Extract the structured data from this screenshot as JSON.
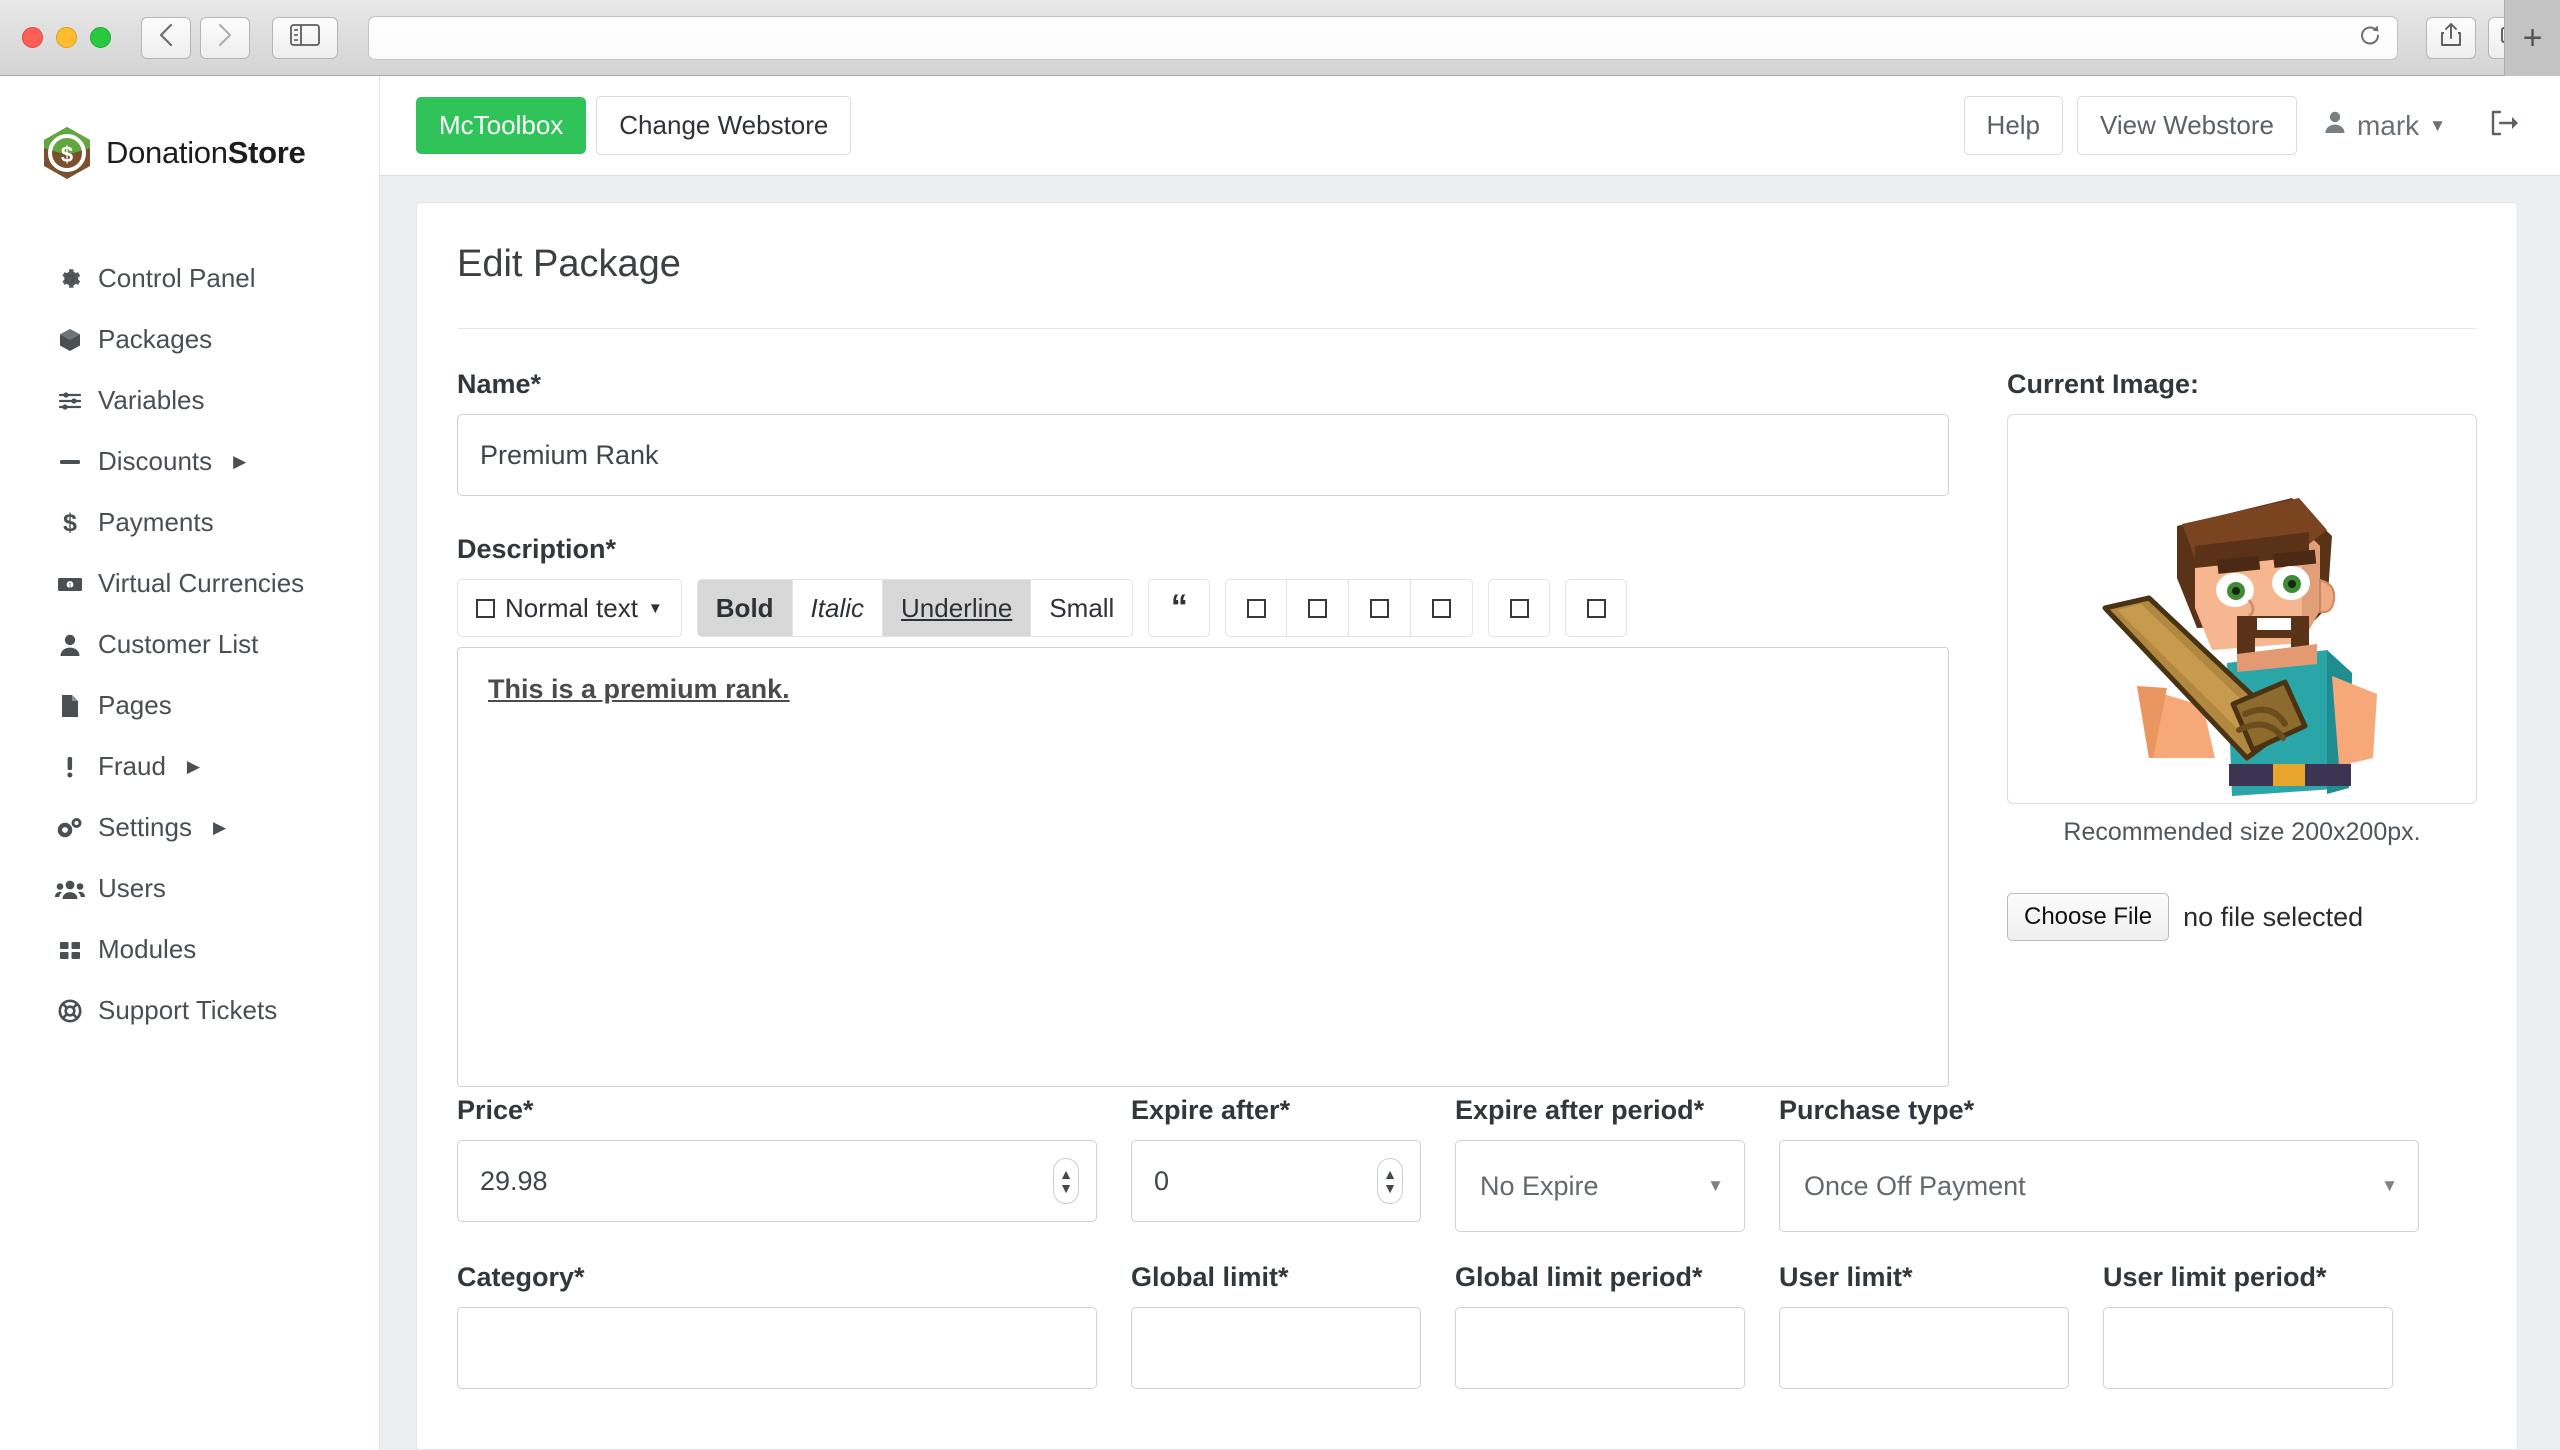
{
  "browser": {
    "url_value": "",
    "url_placeholder": "",
    "back_icon": "chevron-left-icon",
    "forward_icon": "chevron-right-icon",
    "sidebar_icon": "sidebar-toggle-icon",
    "reload_icon": "reload-icon",
    "share_icon": "share-icon",
    "tabs_icon": "tab-overview-icon",
    "newtab_label": "+"
  },
  "sidebar": {
    "brand": {
      "name_light": "Donation",
      "name_bold": "Store",
      "logo_icon": "donationstore-logo"
    },
    "items": [
      {
        "label": "Control Panel",
        "icon": "gear-icon",
        "has_submenu": false
      },
      {
        "label": "Packages",
        "icon": "box-icon",
        "has_submenu": false
      },
      {
        "label": "Variables",
        "icon": "sliders-icon",
        "has_submenu": false
      },
      {
        "label": "Discounts",
        "icon": "minus-icon",
        "has_submenu": true
      },
      {
        "label": "Payments",
        "icon": "dollar-icon",
        "has_submenu": false
      },
      {
        "label": "Virtual Currencies",
        "icon": "banknote-icon",
        "has_submenu": false
      },
      {
        "label": "Customer List",
        "icon": "user-icon",
        "has_submenu": false
      },
      {
        "label": "Pages",
        "icon": "file-icon",
        "has_submenu": false
      },
      {
        "label": "Fraud",
        "icon": "exclamation-icon",
        "has_submenu": true
      },
      {
        "label": "Settings",
        "icon": "gears-icon",
        "has_submenu": true
      },
      {
        "label": "Users",
        "icon": "users-icon",
        "has_submenu": false
      },
      {
        "label": "Modules",
        "icon": "grid-icon",
        "has_submenu": false
      },
      {
        "label": "Support Tickets",
        "icon": "lifering-icon",
        "has_submenu": false
      }
    ]
  },
  "topbar": {
    "webstore_name": "McToolbox",
    "change_webstore_label": "Change Webstore",
    "help_label": "Help",
    "view_webstore_label": "View Webstore",
    "username": "mark",
    "user_icon": "user-icon",
    "user_caret": "caret-down-icon",
    "logout_icon": "logout-icon"
  },
  "page": {
    "title": "Edit Package",
    "name": {
      "label": "Name*",
      "value": "Premium Rank"
    },
    "description": {
      "label": "Description*",
      "body_text": "This is a premium rank.",
      "toolbar": {
        "style_select": "Normal text",
        "style_select_icon": "tofu-box-icon",
        "style_caret": "caret-down-icon",
        "bold": "Bold",
        "italic": "Italic",
        "underline": "Underline",
        "small": "Small",
        "quote_icon": "blockquote-icon",
        "icon_buttons": [
          "tofu-box-icon",
          "tofu-box-icon",
          "tofu-box-icon",
          "tofu-box-icon",
          "tofu-box-icon",
          "tofu-box-icon"
        ],
        "active": [
          "Bold",
          "Underline"
        ]
      }
    },
    "current_image": {
      "label": "Current Image:",
      "caption": "Recommended size 200x200px.",
      "choose_file_label": "Choose File",
      "file_status": "no file selected",
      "image_icon": "minecraft-steve-avatar"
    },
    "fields": {
      "price": {
        "label": "Price*",
        "value": "29.98",
        "type": "number"
      },
      "expire_after": {
        "label": "Expire after*",
        "value": "0",
        "type": "number"
      },
      "expire_after_period": {
        "label": "Expire after period*",
        "value": "No Expire",
        "type": "select"
      },
      "purchase_type": {
        "label": "Purchase type*",
        "value": "Once Off Payment",
        "type": "select"
      },
      "category": {
        "label": "Category*",
        "value": "",
        "type": "select"
      },
      "global_limit": {
        "label": "Global limit*",
        "value": "",
        "type": "number"
      },
      "global_limit_period": {
        "label": "Global limit period*",
        "value": "",
        "type": "select"
      },
      "user_limit": {
        "label": "User limit*",
        "value": "",
        "type": "number"
      },
      "user_limit_period": {
        "label": "User limit period*",
        "value": "",
        "type": "select"
      }
    }
  },
  "colors": {
    "brand_green": "#2fc359",
    "sidebar_text": "#4a4f54",
    "page_bg": "#eceff1"
  }
}
